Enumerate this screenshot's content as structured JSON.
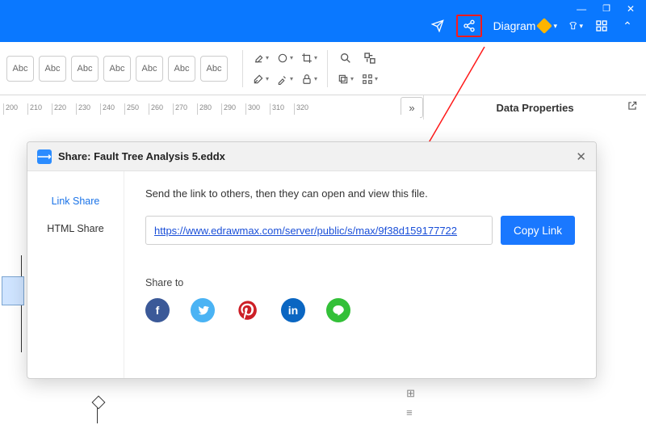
{
  "titlebar": {
    "diagram_label": "Diagram"
  },
  "toolbar": {
    "abc": "Abc"
  },
  "ruler": {
    "ticks": [
      "200",
      "210",
      "220",
      "230",
      "240",
      "250",
      "260",
      "270",
      "280",
      "290",
      "300",
      "310",
      "320"
    ]
  },
  "panel": {
    "title": "Data Properties"
  },
  "modal": {
    "title": "Share: Fault Tree Analysis 5.eddx",
    "tabs": {
      "link": "Link Share",
      "html": "HTML Share"
    },
    "desc": "Send the link to others, then they can open and view this file.",
    "url": "https://www.edrawmax.com/server/public/s/max/9f38d159177722",
    "copy": "Copy Link",
    "share_to": "Share to",
    "socials": {
      "facebook": "f",
      "twitter": "t",
      "pinterest": "p",
      "linkedin": "in",
      "line": "L"
    }
  }
}
